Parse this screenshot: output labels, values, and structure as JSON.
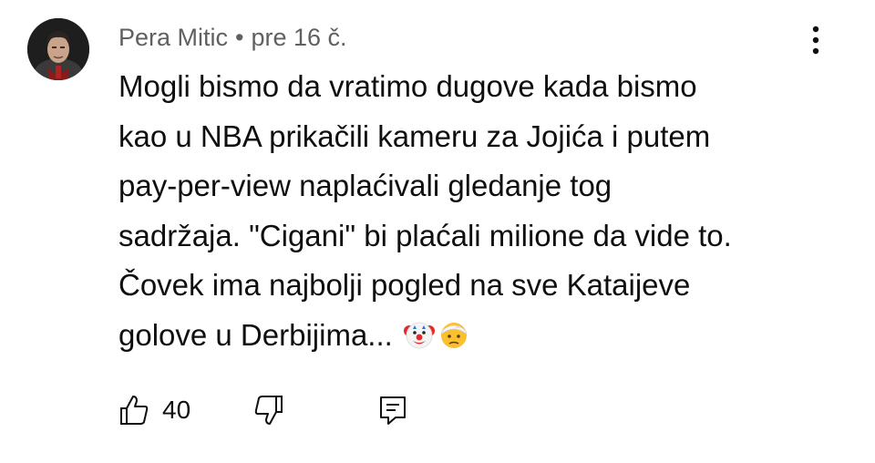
{
  "comment": {
    "author": "Pera Mitic",
    "separator": "•",
    "time_ago": "pre 16 č.",
    "lines": [
      "Mogli bismo da vratimo dugove kada bismo",
      "kao u NBA prikačili kameru za Jojića i putem",
      "pay-per-view naplaćivali gledanje tog",
      "sadržaja. \"Cigani\" bi plaćali milione da vide to.",
      "Čovek ima najbolji pogled na sve Kataijeve",
      "golove u Derbijima..."
    ],
    "emojis": [
      "clown-face",
      "face-with-head-bandage"
    ],
    "like_count": "40"
  },
  "icons": {
    "more": "more-vertical-icon",
    "like": "thumbs-up-icon",
    "dislike": "thumbs-down-icon",
    "reply": "reply-comment-icon"
  },
  "colors": {
    "text": "#0f0f0f",
    "meta": "#606060",
    "background": "#ffffff"
  }
}
